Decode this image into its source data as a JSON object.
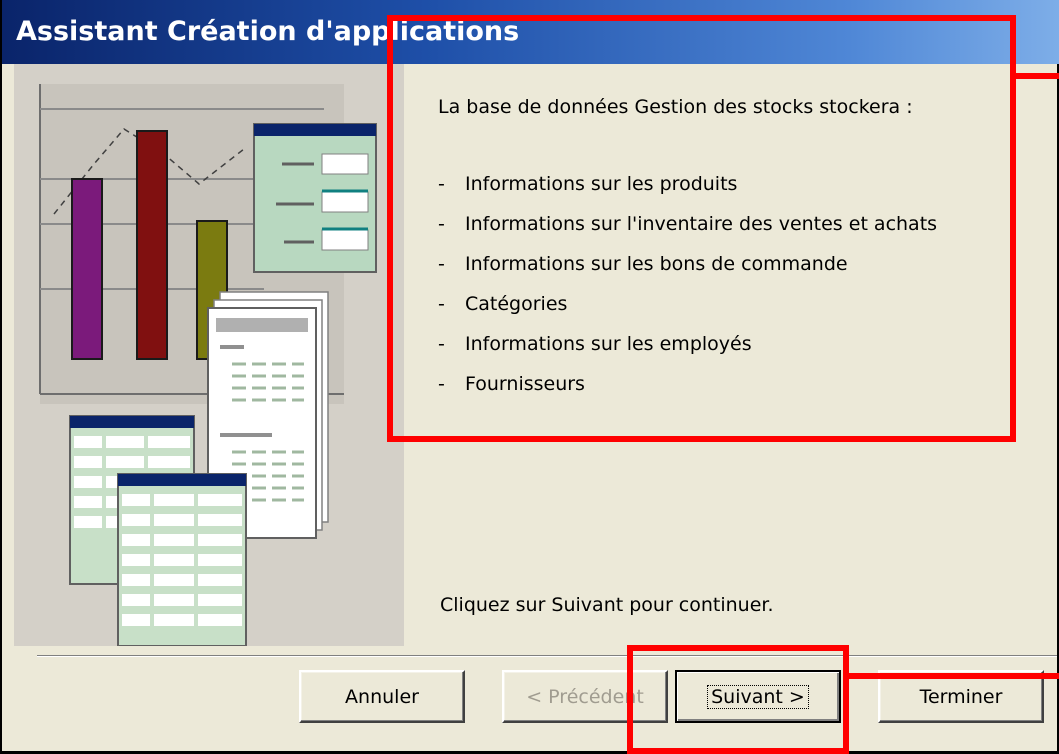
{
  "window": {
    "title": "Assistant Création d'applications"
  },
  "content": {
    "intro": "La base de données Gestion des stocks stockera :",
    "items": [
      "Informations sur les produits",
      "Informations sur l'inventaire des ventes et achats",
      "Informations sur les bons de commande",
      "Catégories",
      "Informations sur les employés",
      "Fournisseurs"
    ],
    "bullet": "-",
    "footer_hint": "Cliquez sur Suivant pour continuer."
  },
  "buttons": {
    "cancel": "Annuler",
    "previous": "< Précédent",
    "next": "Suivant >",
    "finish": "Terminer"
  },
  "colors": {
    "titlebar": "#0a246a",
    "highlight": "#ff0000",
    "dialog_bg": "#ece9d8"
  },
  "icons": [
    "wizard-illustration"
  ]
}
